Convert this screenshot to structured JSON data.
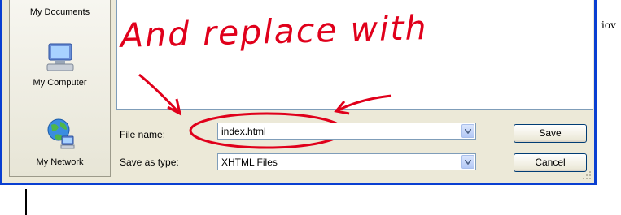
{
  "dialog": {
    "places": [
      {
        "label": "My Documents",
        "icon": "folder-documents-icon"
      },
      {
        "label": "My Computer",
        "icon": "computer-icon"
      },
      {
        "label": "My Network",
        "icon": "network-globe-icon"
      }
    ],
    "file_name_label": "File name:",
    "file_name_value": "index.html",
    "save_as_type_label": "Save as type:",
    "save_as_type_value": "XHTML Files",
    "save_label": "Save",
    "cancel_label": "Cancel"
  },
  "annotation": {
    "text": "And replace with",
    "color": "#e0001b"
  },
  "background_text": "iov"
}
